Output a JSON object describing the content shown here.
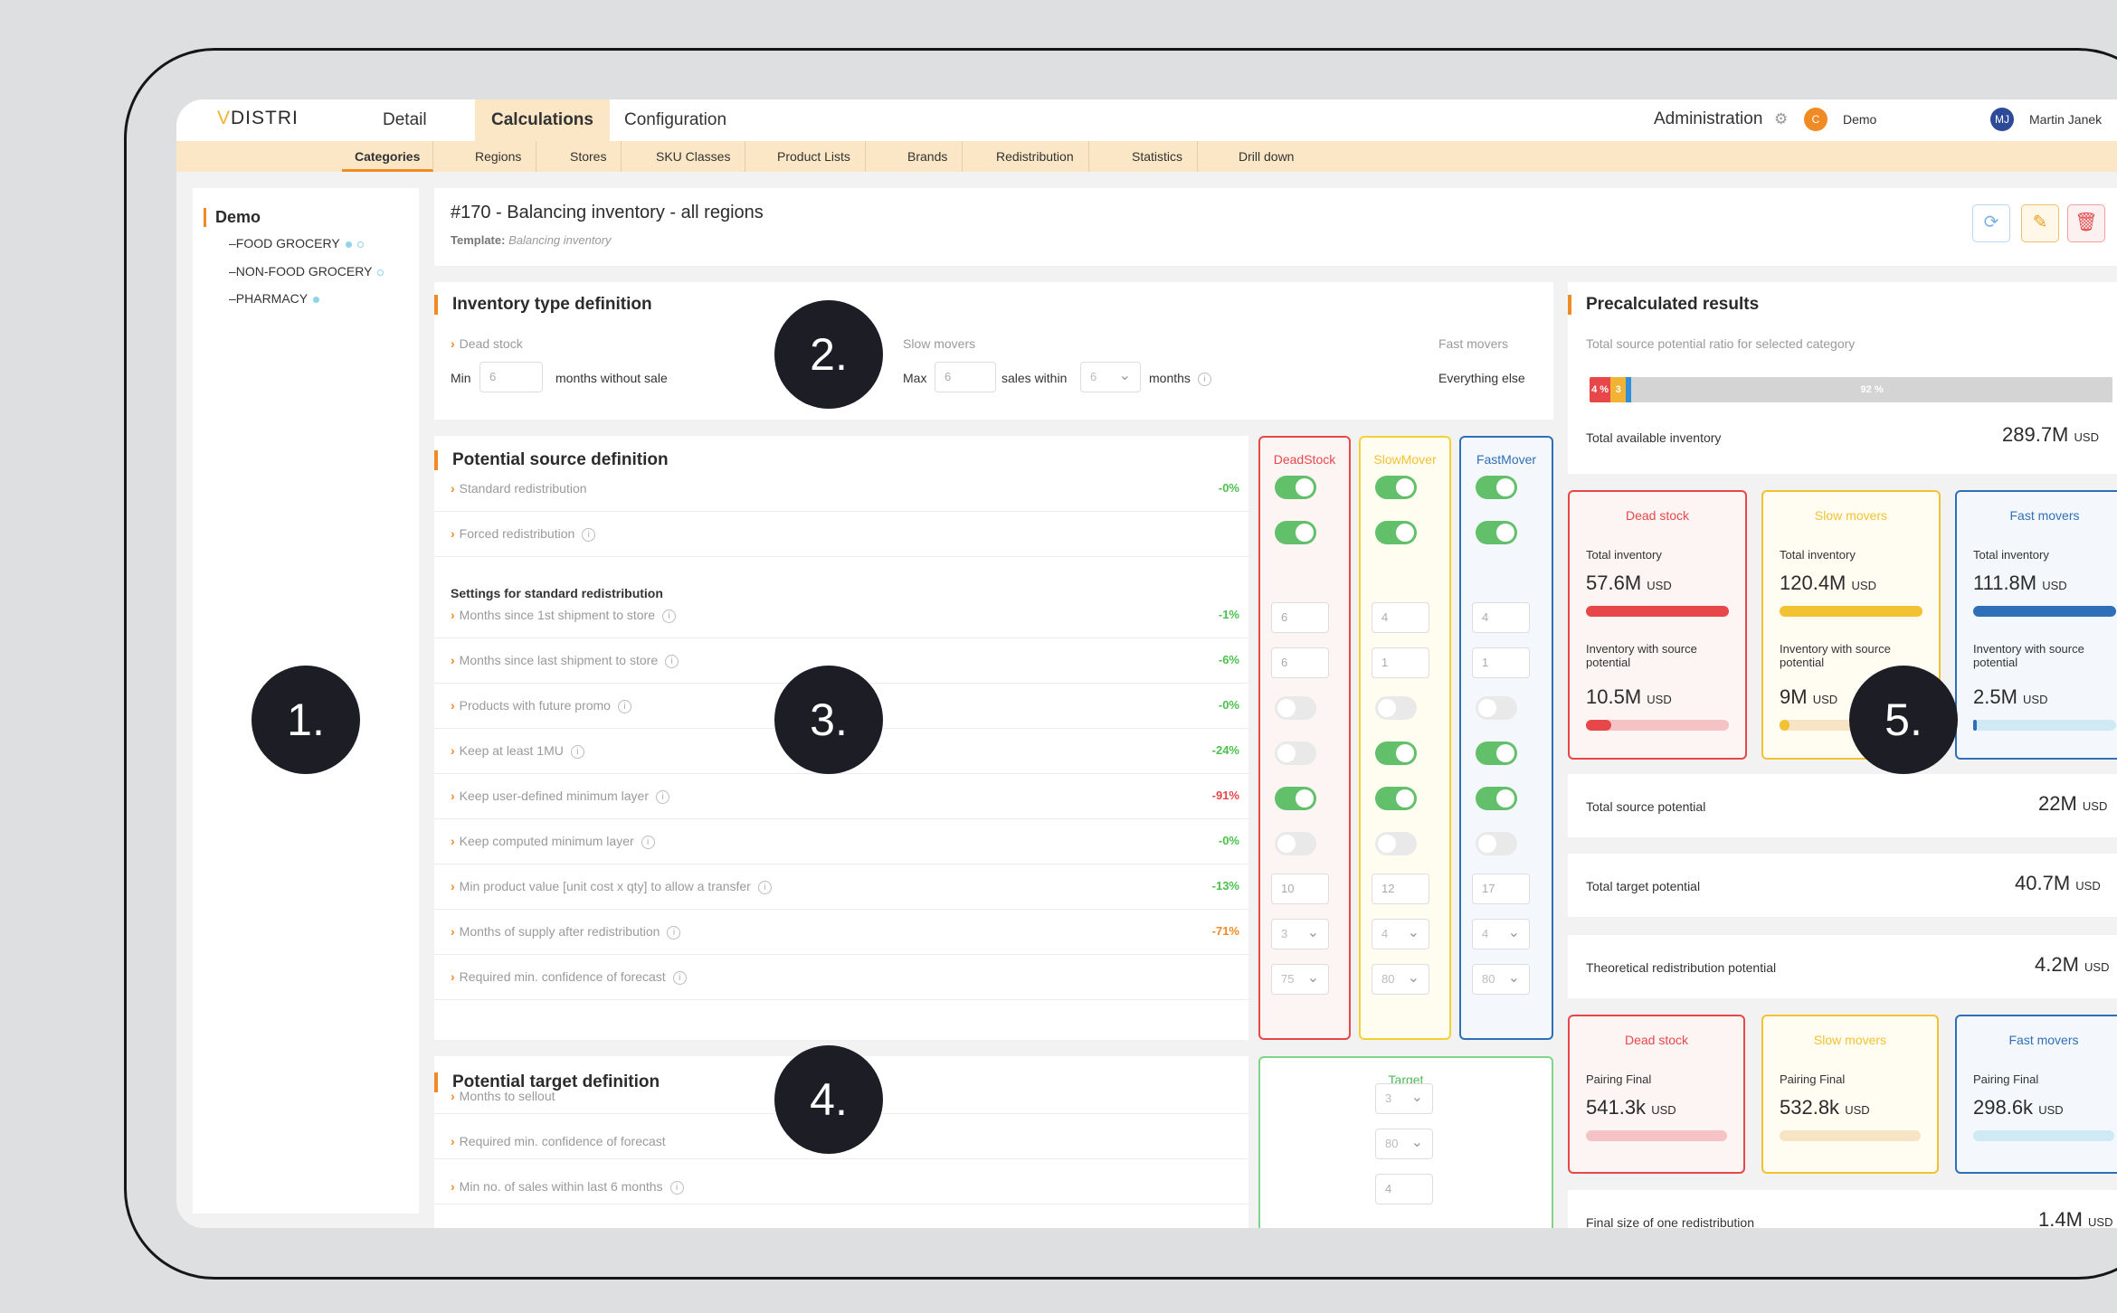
{
  "nav": {
    "logo_prefix": "V",
    "logo_text": "DISTRI",
    "tabs": [
      "Detail",
      "Calculations",
      "Configuration"
    ],
    "active_tab": "Calculations",
    "admin_label": "Administration",
    "org_avatar": "C",
    "org_label": "Demo",
    "user_avatar": "MJ",
    "user_label": "Martin Janek"
  },
  "subnav": [
    "Categories",
    "Regions",
    "Stores",
    "SKU Classes",
    "Product Lists",
    "Brands",
    "Redistribution",
    "Statistics",
    "Drill down"
  ],
  "tree": {
    "root": "Demo",
    "items": [
      "–FOOD GROCERY",
      "–NON-FOOD GROCERY",
      "–PHARMACY"
    ]
  },
  "header": {
    "title": "#170 - Balancing inventory - all regions",
    "template_label": "Template:",
    "template_value": "Balancing inventory"
  },
  "inventory_type": {
    "title": "Inventory type definition",
    "dead_stock": "Dead stock",
    "min_label": "Min",
    "min_value": "6",
    "months_without_sale": "months without sale",
    "slow_movers": "Slow movers",
    "max_label": "Max",
    "max_value": "6",
    "sales_within": "sales within",
    "sales_within_value": "6",
    "months": "months",
    "fast_movers": "Fast movers",
    "everything_else": "Everything else"
  },
  "source": {
    "title": "Potential source definition",
    "columns": [
      "DeadStock",
      "SlowMover",
      "FastMover"
    ],
    "top_rows": [
      {
        "label": "Standard redistribution",
        "pct": "-0%",
        "info": false,
        "cells": [
          "on",
          "on",
          "on"
        ]
      },
      {
        "label": "Forced redistribution",
        "pct": "",
        "info": true,
        "cells": [
          "on",
          "on",
          "on"
        ]
      }
    ],
    "settings_title": "Settings for standard redistribution",
    "rows": [
      {
        "label": "Months since 1st shipment to store",
        "pct": "-1%",
        "color": "green",
        "cells": [
          "6",
          "4",
          "4"
        ],
        "kind": "input"
      },
      {
        "label": "Months since last shipment to store",
        "pct": "-6%",
        "color": "green",
        "cells": [
          "6",
          "1",
          "1"
        ],
        "kind": "input"
      },
      {
        "label": "Products with future promo",
        "pct": "-0%",
        "color": "green",
        "cells": [
          "off",
          "off",
          "off"
        ],
        "kind": "toggle"
      },
      {
        "label": "Keep at least 1MU",
        "pct": "-24%",
        "color": "green",
        "cells": [
          "off",
          "on",
          "on"
        ],
        "kind": "toggle"
      },
      {
        "label": "Keep user-defined minimum layer",
        "pct": "-91%",
        "color": "red",
        "cells": [
          "on",
          "on",
          "on"
        ],
        "kind": "toggle"
      },
      {
        "label": "Keep computed minimum layer",
        "pct": "-0%",
        "color": "green",
        "cells": [
          "off",
          "off",
          "off"
        ],
        "kind": "toggle"
      },
      {
        "label": "Min product value [unit cost x qty] to allow a transfer",
        "pct": "-13%",
        "color": "green",
        "cells": [
          "10",
          "12",
          "17"
        ],
        "kind": "input"
      },
      {
        "label": "Months of supply after redistribution",
        "pct": "-71%",
        "color": "orange",
        "cells": [
          "3",
          "4",
          "4"
        ],
        "kind": "select"
      },
      {
        "label": "Required min. confidence of forecast",
        "pct": "",
        "color": "green",
        "cells": [
          "75",
          "80",
          "80"
        ],
        "kind": "select"
      }
    ]
  },
  "target": {
    "title": "Potential target definition",
    "column": "Target",
    "rows": [
      {
        "label": "Months to sellout",
        "value": "3",
        "kind": "select",
        "info": false
      },
      {
        "label": "Required min. confidence of forecast",
        "value": "80",
        "kind": "select",
        "info": false
      },
      {
        "label": "Min no. of sales within last 6 months",
        "value": "4",
        "kind": "input",
        "info": true
      }
    ]
  },
  "results": {
    "title": "Precalculated results",
    "ratio_label": "Total source potential ratio for selected category",
    "ratio_segments": [
      {
        "label": "4 %",
        "value": 4,
        "color": "#e8474a"
      },
      {
        "label": "3 %",
        "value": 3,
        "color": "#f2b233"
      },
      {
        "label": "",
        "value": 1,
        "color": "#2f8fd8"
      },
      {
        "label": "92 %",
        "value": 92,
        "color": "#d4d4d4"
      }
    ],
    "total_available_label": "Total available inventory",
    "total_available_value": "289.7M",
    "currency": "USD",
    "kpis": [
      {
        "name": "Dead stock",
        "color": "#e8474a",
        "bg": "#fdf4f4",
        "total_label": "Total inventory",
        "total": "57.6M",
        "total_fill": 1.0,
        "potential_label": "Inventory with source potential",
        "potential": "10.5M",
        "potential_fill": 0.18,
        "light": "#f5c3c4"
      },
      {
        "name": "Slow movers",
        "color": "#f2c233",
        "bg": "#fffcf2",
        "total_label": "Total inventory",
        "total": "120.4M",
        "total_fill": 1.0,
        "potential_label": "Inventory with source potential",
        "potential": "9M",
        "potential_fill": 0.07,
        "light": "#f6e4c4"
      },
      {
        "name": "Fast movers",
        "color": "#2f6fb8",
        "bg": "#f4f8fc",
        "total_label": "Total inventory",
        "total": "111.8M",
        "total_fill": 1.0,
        "potential_label": "Inventory with source potential",
        "potential": "2.5M",
        "potential_fill": 0.02,
        "light": "#cfe9f5"
      }
    ],
    "source_potential_label": "Total source potential",
    "source_potential_value": "22M",
    "target_potential_label": "Total target potential",
    "target_potential_value": "40.7M",
    "theoretical_label": "Theoretical redistribution potential",
    "theoretical_value": "4.2M",
    "pairing": [
      {
        "name": "Dead stock",
        "label": "Pairing Final",
        "value": "541.3k"
      },
      {
        "name": "Slow movers",
        "label": "Pairing Final",
        "value": "532.8k"
      },
      {
        "name": "Fast movers",
        "label": "Pairing Final",
        "value": "298.6k"
      }
    ],
    "final_size_label": "Final size of one redistribution",
    "final_size_value": "1.4M"
  },
  "markers": [
    "1.",
    "2.",
    "3.",
    "4.",
    "5."
  ]
}
